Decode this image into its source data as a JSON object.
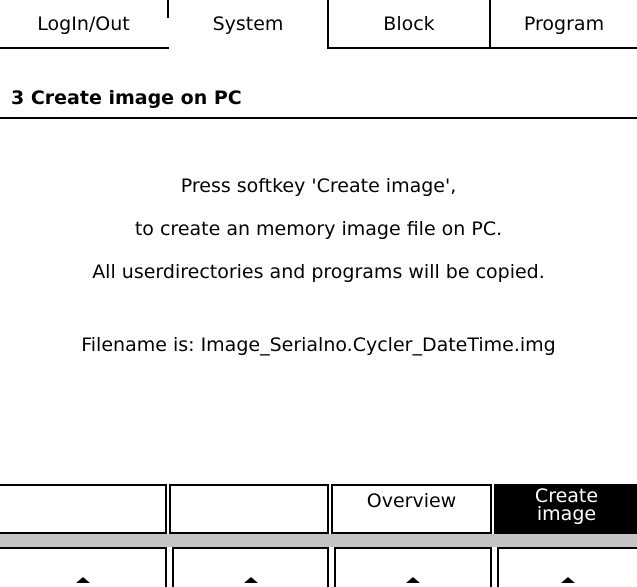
{
  "tabs": [
    {
      "label": "LogIn/Out"
    },
    {
      "label": "System"
    },
    {
      "label": "Block"
    },
    {
      "label": "Program"
    }
  ],
  "screen": {
    "title": "3  Create image on PC",
    "message": {
      "line1": "Press softkey 'Create image',",
      "line2": "to create an memory image file on PC.",
      "line3": "All userdirectories and programs will be copied.",
      "filename": "Filename is: Image_Serialno.Cycler_DateTime.img"
    }
  },
  "softkeys": [
    {
      "label": ""
    },
    {
      "label": ""
    },
    {
      "label": "Overview"
    },
    {
      "label_line1": "Create",
      "label_line2": "image"
    }
  ],
  "hardkeys": [
    {
      "icon": "up-arrow-icon"
    },
    {
      "icon": "up-arrow-icon"
    },
    {
      "icon": "up-arrow-icon"
    },
    {
      "icon": "up-arrow-icon"
    }
  ],
  "colors": {
    "foreground": "#000000",
    "background": "#ffffff",
    "band": "#c4c4c4"
  }
}
